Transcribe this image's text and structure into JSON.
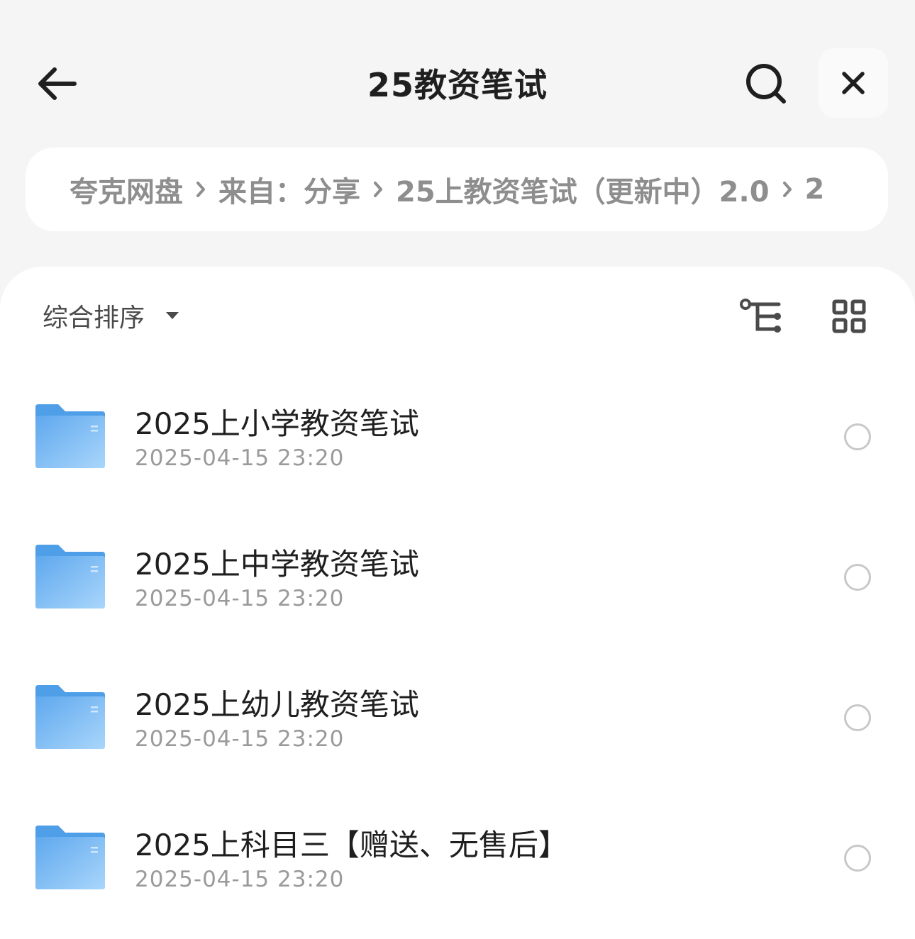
{
  "header": {
    "title": "25教资笔试",
    "back_icon": "arrow-left-icon",
    "search_icon": "search-icon",
    "close_icon": "close-icon"
  },
  "breadcrumb": {
    "items": [
      "夸克网盘",
      "来自：分享",
      "25上教资笔试（更新中）2.0",
      "2"
    ],
    "separator_icon": "chevron-right-icon"
  },
  "toolbar": {
    "sort_label": "综合排序",
    "sort_caret_icon": "caret-down-icon",
    "tree_icon": "tree-view-icon",
    "grid_icon": "grid-view-icon"
  },
  "files": [
    {
      "name": "2025上小学教资笔试",
      "date": "2025-04-15 23:20",
      "icon": "folder-icon"
    },
    {
      "name": "2025上中学教资笔试",
      "date": "2025-04-15 23:20",
      "icon": "folder-icon"
    },
    {
      "name": "2025上幼儿教资笔试",
      "date": "2025-04-15 23:20",
      "icon": "folder-icon"
    },
    {
      "name": "2025上科目三【赠送、无售后】",
      "date": "2025-04-15 23:20",
      "icon": "folder-icon"
    }
  ],
  "colors": {
    "background": "#f5f5f5",
    "panel": "#ffffff",
    "title_text": "#1f1f1f",
    "secondary_text": "#9a9a9a",
    "folder_blue": "#6fb4f2"
  }
}
